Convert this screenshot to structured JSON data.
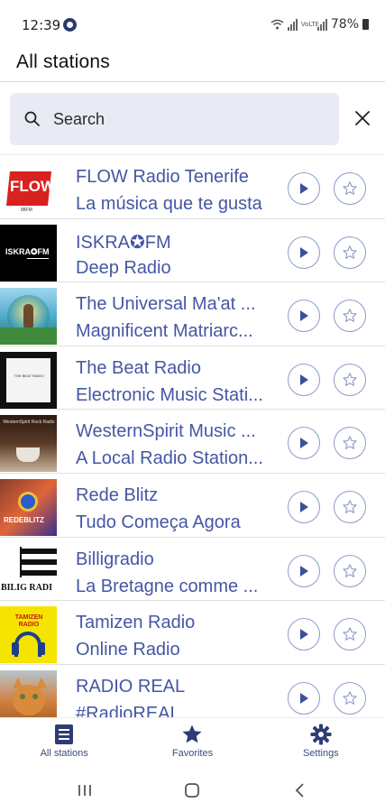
{
  "status_bar": {
    "time": "12:39",
    "network_label": "VoLTE",
    "battery": "78%"
  },
  "header": {
    "title": "All stations"
  },
  "search": {
    "placeholder": "Search",
    "value": ""
  },
  "stations": [
    {
      "name": "FLOW Radio Tenerife",
      "description": "La música que te gusta",
      "logo_text": "FLOW",
      "logo_subtext": "88FM"
    },
    {
      "name": "ISKRA✪FM",
      "description": "Deep Radio",
      "logo_text": "ISKRA✪FM"
    },
    {
      "name": "The Universal Ma'at ...",
      "description": "Magnificent Matriarc..."
    },
    {
      "name": "The Beat Radio",
      "description": "Electronic Music Stati...",
      "logo_text": "THE BEAT RADIO"
    },
    {
      "name": "WesternSpirit Music ...",
      "description": "A Local Radio Station...",
      "logo_text": "WesternSpirit Rock Radio"
    },
    {
      "name": "Rede Blitz",
      "description": "Tudo Começa Agora",
      "logo_text": "REDEBLITZ"
    },
    {
      "name": "Billigradio",
      "description": "La Bretagne comme ...",
      "logo_text": "BILIG RADI"
    },
    {
      "name": "Tamizen Radio",
      "description": "Online Radio",
      "logo_text": "TAMIZEN RADIO"
    },
    {
      "name": "RADIO REAL",
      "description": "#RadioREAL"
    }
  ],
  "bottom_nav": {
    "all_stations": "All stations",
    "favorites": "Favorites",
    "settings": "Settings"
  },
  "colors": {
    "accent": "#4457a4",
    "nav": "#3d4a7f",
    "search_bg": "#e8ebf3"
  }
}
